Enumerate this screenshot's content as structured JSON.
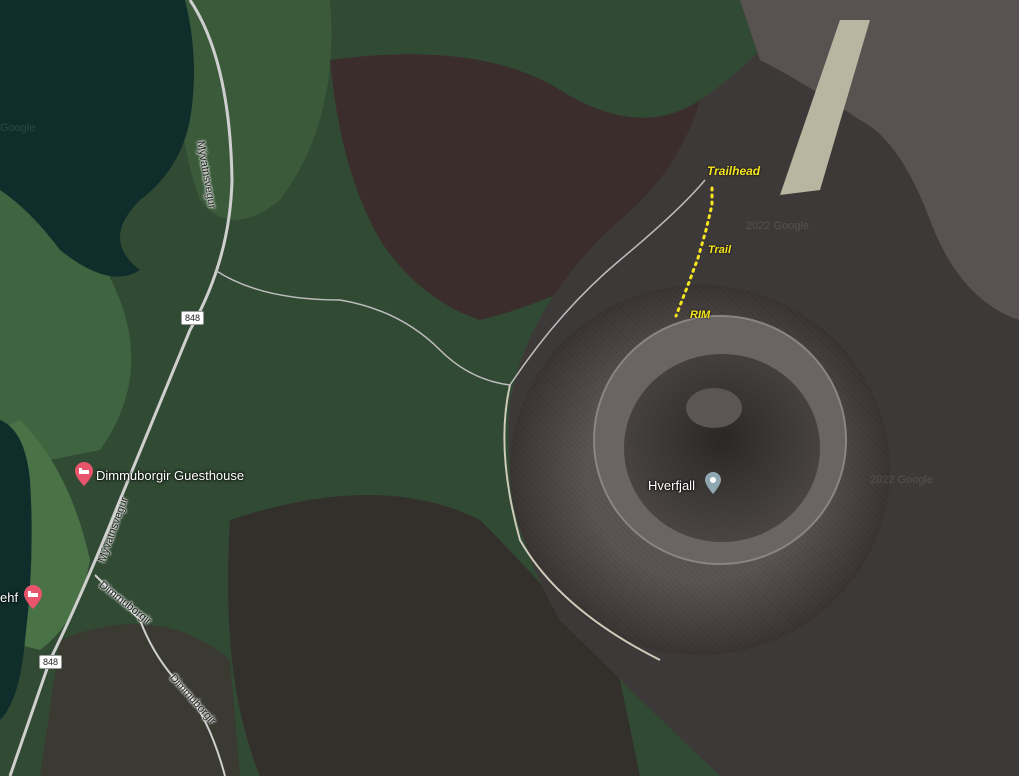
{
  "map": {
    "colors": {
      "lake": "#0f2e2b",
      "forest": "#2f4a32",
      "lava": "#3b2a2a",
      "crater": "#46403f",
      "annotation": "#f5e51f",
      "lodging_pin": "#e8546c",
      "place_pin": "#8fa7b0"
    },
    "roads": [
      {
        "label": "Mývatnsvegur"
      },
      {
        "label": "Mývatnsvegur"
      },
      {
        "label": "Dimmuborgir"
      },
      {
        "label": "Dimmuborgir"
      }
    ],
    "route_shields": [
      "848",
      "848"
    ],
    "places": [
      {
        "label": "Dimmuborgir Guesthouse",
        "icon": "bed-icon"
      },
      {
        "label": "ehf",
        "icon": "bed-icon"
      },
      {
        "label": "Hverfjall",
        "icon": "map-pin-icon"
      }
    ],
    "annotations": {
      "trailhead": "Trailhead",
      "trail": "Trail",
      "rim": "RIM"
    },
    "watermark": "Google",
    "copyright": "2022 Google"
  }
}
